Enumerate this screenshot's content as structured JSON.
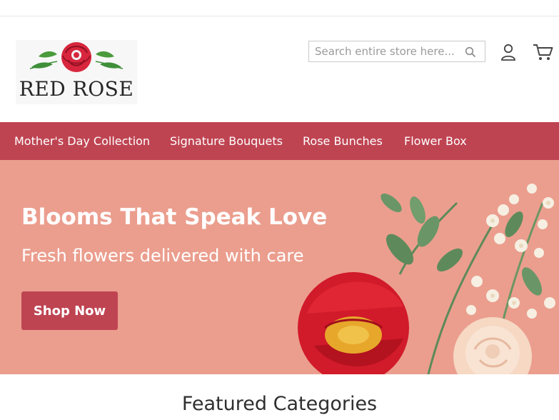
{
  "brand": {
    "name": "RED ROSE"
  },
  "search": {
    "placeholder": "Search entire store here...",
    "icon": "search-icon"
  },
  "header_icons": {
    "account": "account-icon",
    "cart": "cart-icon"
  },
  "nav": {
    "items": [
      {
        "label": "Mother's Day Collection"
      },
      {
        "label": "Signature Bouquets"
      },
      {
        "label": "Rose Bunches"
      },
      {
        "label": "Flower Box"
      }
    ]
  },
  "hero": {
    "title": "Blooms That Speak Love",
    "subtitle": "Fresh flowers delivered with care",
    "button_label": "Shop Now"
  },
  "featured": {
    "title": "Featured Categories"
  },
  "colors": {
    "accent": "#bf4452",
    "hero_bg": "#eb9e8e",
    "logo_rose": "#d7263d",
    "leaf": "#3f8f3a"
  }
}
